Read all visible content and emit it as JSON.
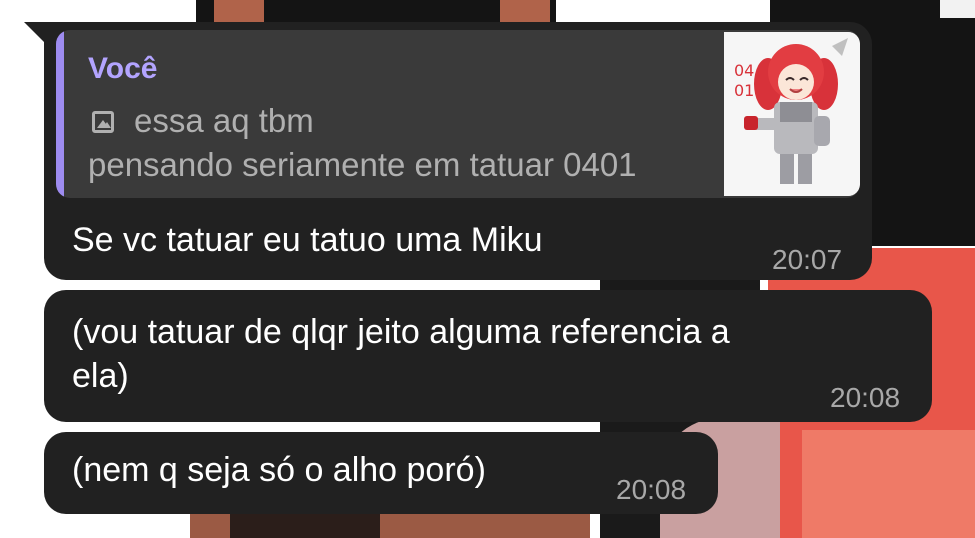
{
  "messages": [
    {
      "reply": {
        "author": "Você",
        "line1": "essa aq tbm",
        "line2": "pensando seriamente em tatuar 0401",
        "media_icon": "image-icon",
        "thumb_text": "04 01"
      },
      "text": "Se vc tatuar eu tatuo uma Miku",
      "time": "20:07"
    },
    {
      "text": "(vou tatuar de qlqr jeito alguma referencia a\nela)",
      "time": "20:08"
    },
    {
      "text": "(nem q seja só o alho poró)",
      "time": "20:08"
    }
  ],
  "colors": {
    "bubble": "#212121",
    "reply_accent": "#9e8cf0",
    "reply_author": "#b3a4ff",
    "time": "#a8a8a8"
  }
}
